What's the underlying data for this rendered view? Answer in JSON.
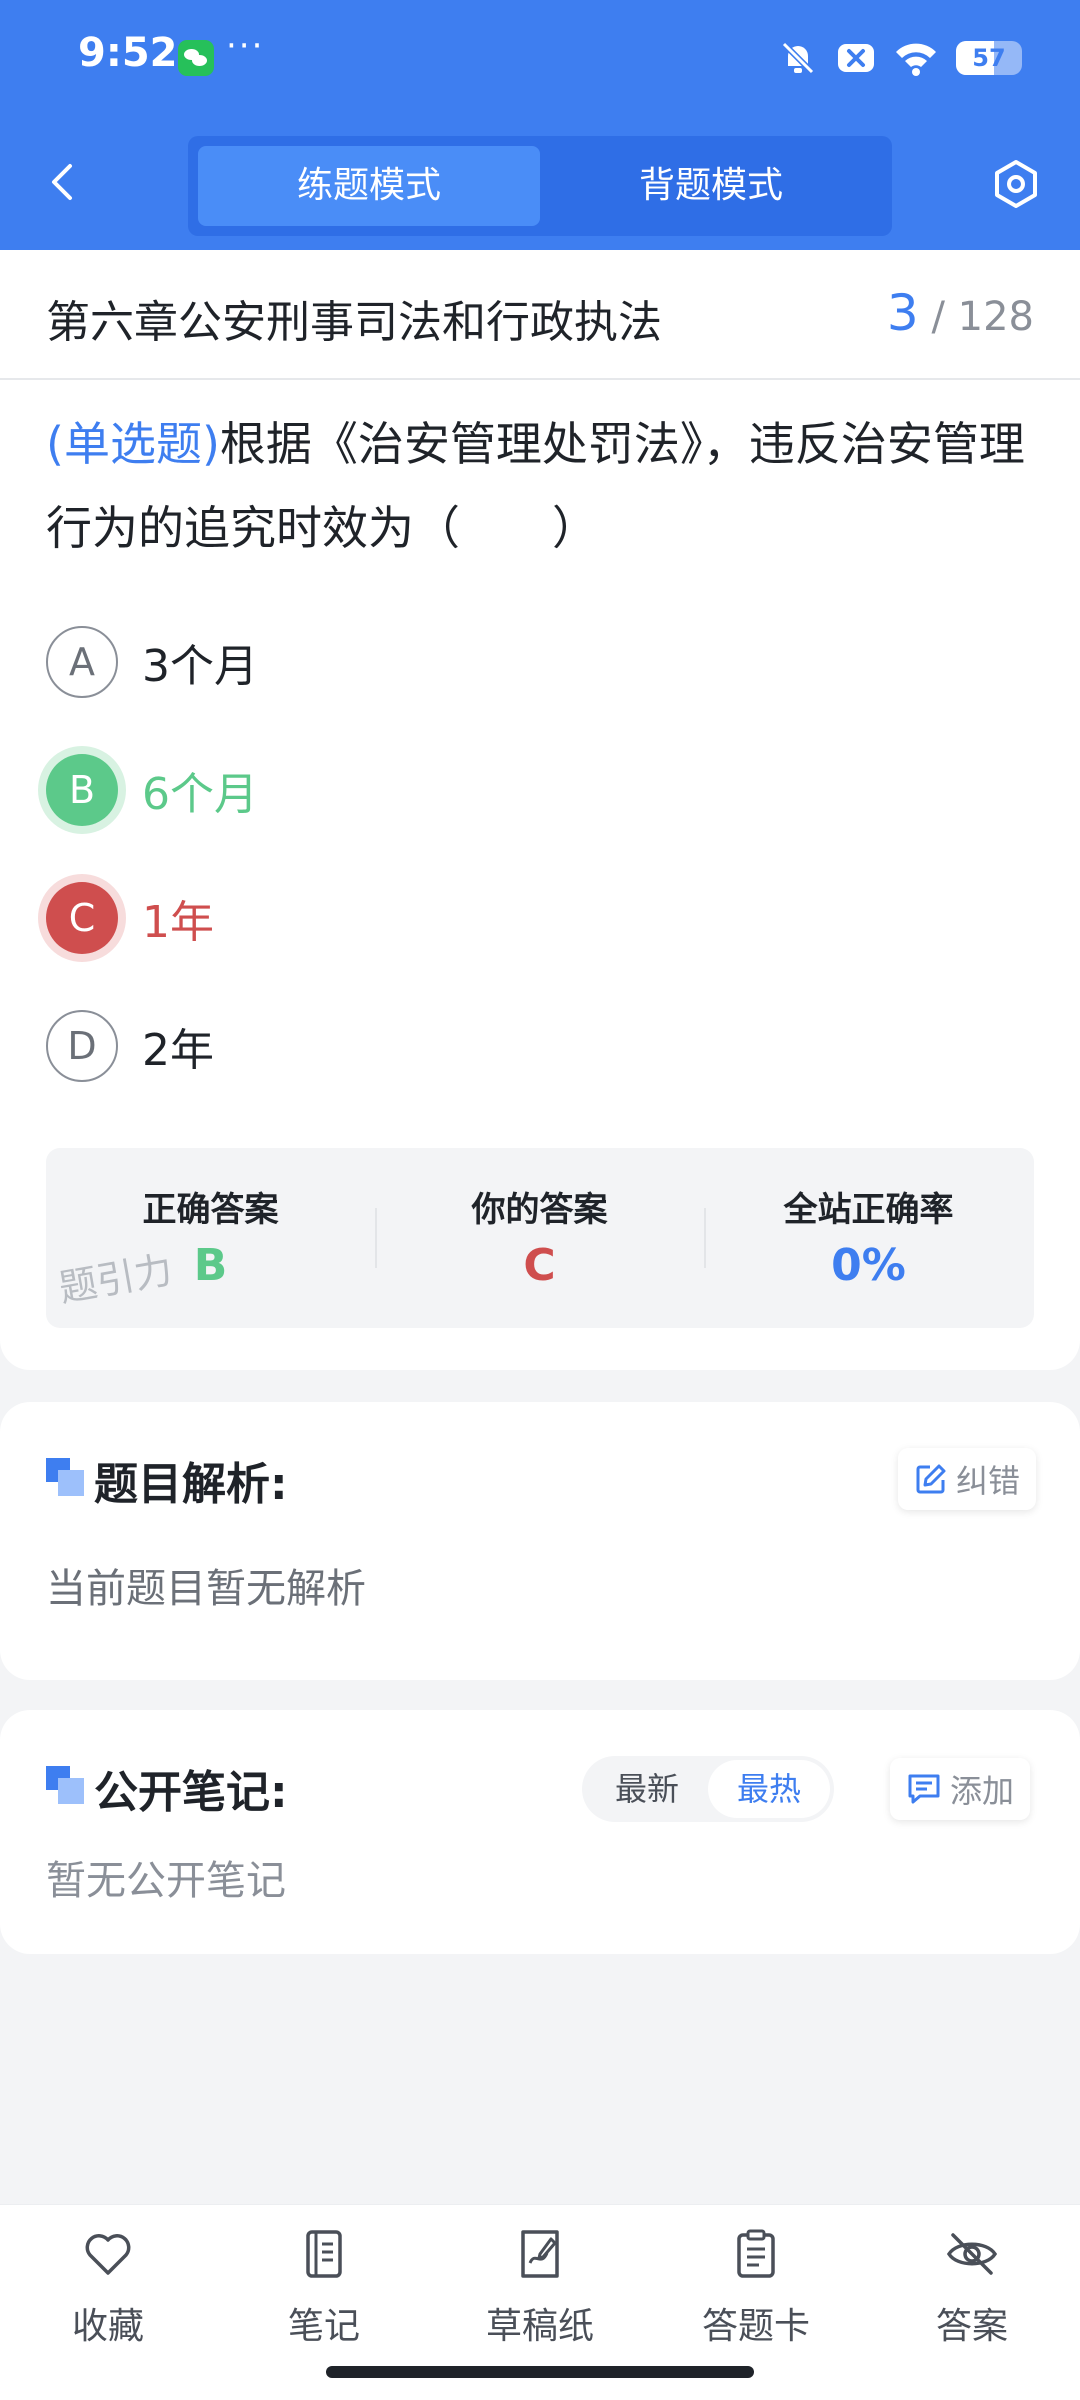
{
  "status_bar": {
    "time": "9:52",
    "more": "···",
    "battery": "57"
  },
  "header": {
    "tabs": [
      {
        "label": "练题模式",
        "active": true
      },
      {
        "label": "背题模式",
        "active": false
      }
    ]
  },
  "chapter": {
    "title": "第六章公安刑事司法和行政执法",
    "current": "3",
    "total": "/ 128"
  },
  "question": {
    "type": "(单选题)",
    "text": "根据《治安管理处罚法》，违反治安管理行为的追究时效为（　　）",
    "options": [
      {
        "letter": "A",
        "text": "3个月",
        "state": "normal"
      },
      {
        "letter": "B",
        "text": "6个月",
        "state": "correct"
      },
      {
        "letter": "C",
        "text": "1年",
        "state": "wrong"
      },
      {
        "letter": "D",
        "text": "2年",
        "state": "normal"
      }
    ]
  },
  "answer_summary": {
    "correct_label": "正确答案",
    "correct_value": "B",
    "yours_label": "你的答案",
    "yours_value": "C",
    "rate_label": "全站正确率",
    "rate_value": "0%",
    "watermark": "题引力"
  },
  "analysis": {
    "title": "题目解析:",
    "report_label": "纠错",
    "body": "当前题目暂无解析"
  },
  "notes": {
    "title": "公开笔记:",
    "sort_options": [
      "最新",
      "最热"
    ],
    "sort_active": "最热",
    "add_label": "添加",
    "body": "暂无公开笔记"
  },
  "bottom_nav": [
    {
      "label": "收藏",
      "icon": "heart-icon"
    },
    {
      "label": "笔记",
      "icon": "notebook-icon"
    },
    {
      "label": "草稿纸",
      "icon": "draft-paper-icon"
    },
    {
      "label": "答题卡",
      "icon": "answer-card-icon"
    },
    {
      "label": "答案",
      "icon": "eye-off-icon"
    }
  ],
  "colors": {
    "primary": "#3e7ef0",
    "correct": "#5cc98a",
    "wrong": "#cf4e4e"
  }
}
